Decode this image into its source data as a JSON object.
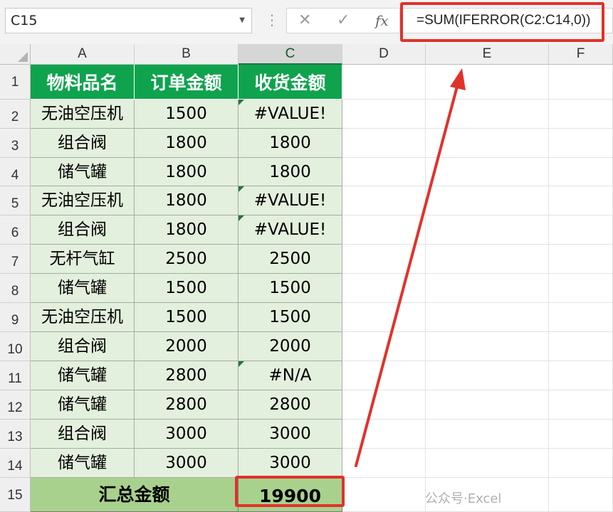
{
  "formula_bar": {
    "name_box": "C15",
    "cancel_icon": "✕",
    "enter_icon": "✓",
    "fx_label": "fx",
    "formula": "=SUM(IFERROR(C2:C14,0))"
  },
  "columns": [
    "A",
    "B",
    "C",
    "D",
    "E",
    "F"
  ],
  "rows": [
    "1",
    "2",
    "3",
    "4",
    "5",
    "6",
    "7",
    "8",
    "9",
    "10",
    "11",
    "12",
    "13",
    "14",
    "15"
  ],
  "table": {
    "headers": [
      "物料品名",
      "订单金额",
      "收货金额"
    ],
    "body": [
      [
        "无油空压机",
        "1500",
        "#VALUE!"
      ],
      [
        "组合阀",
        "1800",
        "1800"
      ],
      [
        "储气罐",
        "1800",
        "1800"
      ],
      [
        "无油空压机",
        "1800",
        "#VALUE!"
      ],
      [
        "组合阀",
        "1800",
        "#VALUE!"
      ],
      [
        "无杆气缸",
        "2500",
        "2500"
      ],
      [
        "储气罐",
        "1500",
        "1500"
      ],
      [
        "无油空压机",
        "1500",
        "1500"
      ],
      [
        "组合阀",
        "2000",
        "2000"
      ],
      [
        "储气罐",
        "2800",
        "#N/A"
      ],
      [
        "储气罐",
        "2800",
        "2800"
      ],
      [
        "组合阀",
        "3000",
        "3000"
      ],
      [
        "储气罐",
        "3000",
        "3000"
      ]
    ],
    "total_label": "汇总金额",
    "total_value": "19900"
  },
  "watermark": "公众号·Excel",
  "colors": {
    "header_green": "#0fa34e",
    "data_bg": "#e3f0dd",
    "total_bg": "#a9d18e",
    "highlight_red": "#e0322b"
  }
}
